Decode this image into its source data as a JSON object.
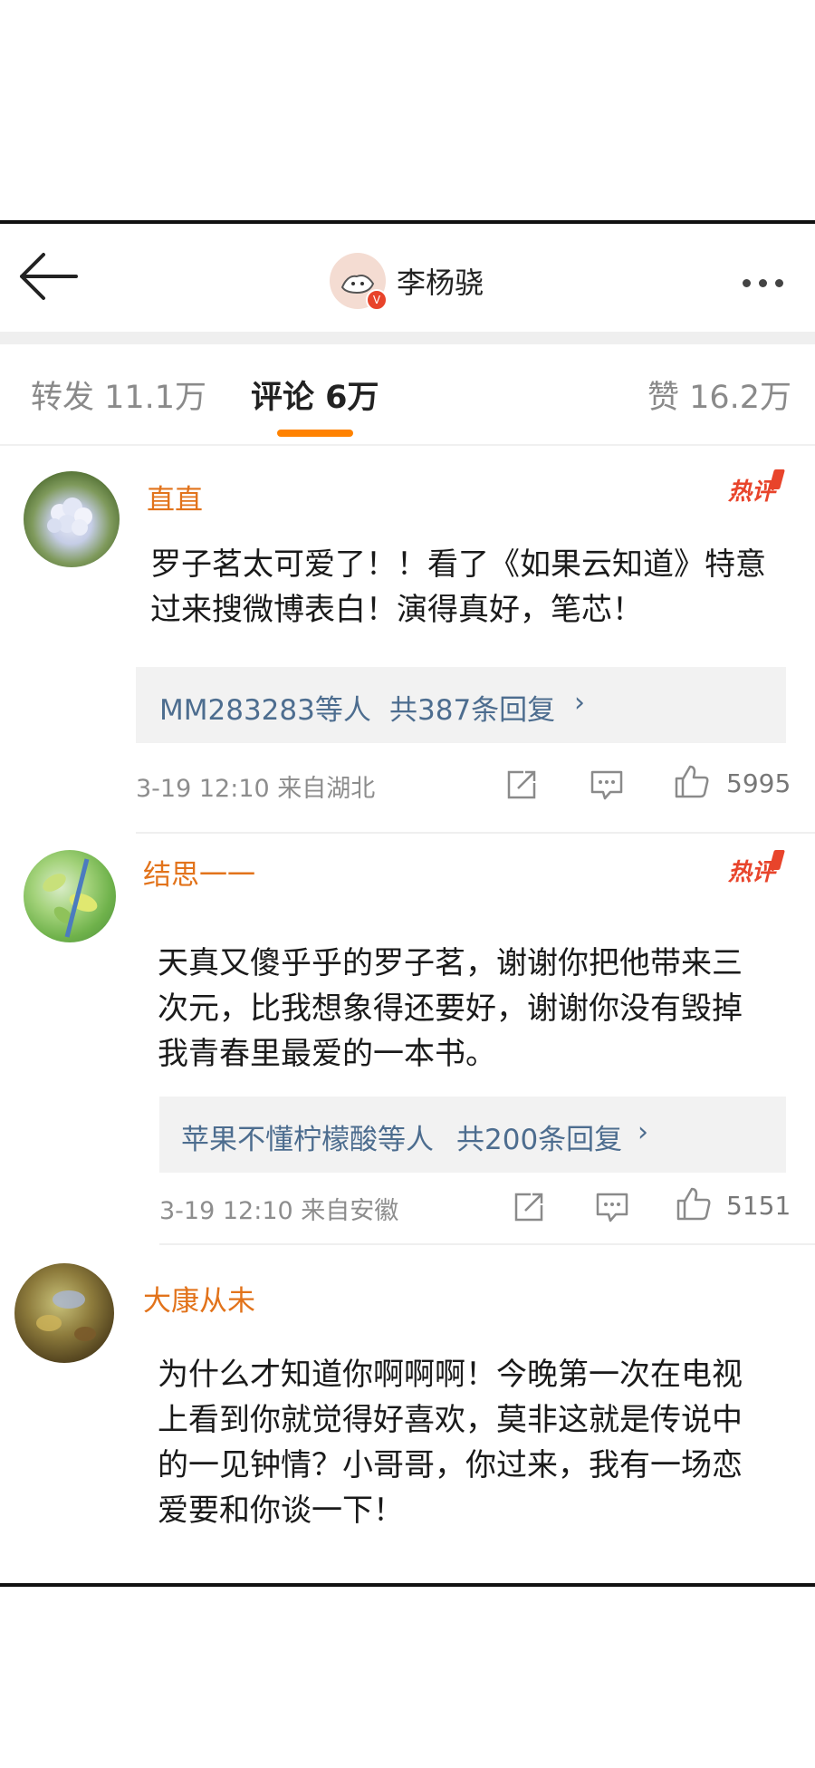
{
  "header": {
    "title": "李杨骁",
    "verified_badge": "V",
    "back_icon": "back-arrow-icon",
    "more_icon": "more-dots-icon"
  },
  "tabs": {
    "repost": "转发 11.1万",
    "comments": "评论 6万",
    "likes": "赞 16.2万",
    "active": "comments",
    "accent_color": "#ff8200"
  },
  "comments": [
    {
      "name": "直直",
      "hot_label": "热评",
      "text": "罗子茗太可爱了！！看了《如果云知道》特意过来搜微博表白！演得真好，笔芯！",
      "reply_users": "MM283283等人",
      "reply_count": "共387条回复",
      "meta": "3-19 12:10  来自湖北",
      "likes": "5995"
    },
    {
      "name": "结思一一",
      "hot_label": "热评",
      "text": "天真又傻乎乎的罗子茗，谢谢你把他带来三次元，比我想象得还要好，谢谢你没有毁掉我青春里最爱的一本书。",
      "reply_users": "苹果不懂柠檬酸等人",
      "reply_count": "共200条回复",
      "meta": "3-19 12:10  来自安徽",
      "likes": "5151"
    },
    {
      "name": "大康从未",
      "text": "为什么才知道你啊啊啊！今晚第一次在电视上看到你就觉得好喜欢，莫非这就是传说中的一见钟情？小哥哥，你过来，我有一场恋爱要和你谈一下！"
    }
  ],
  "chevron": "›",
  "colors": {
    "name_orange": "#e2731b",
    "hot_red": "#e8442b",
    "reply_link": "#4d6d8f"
  }
}
